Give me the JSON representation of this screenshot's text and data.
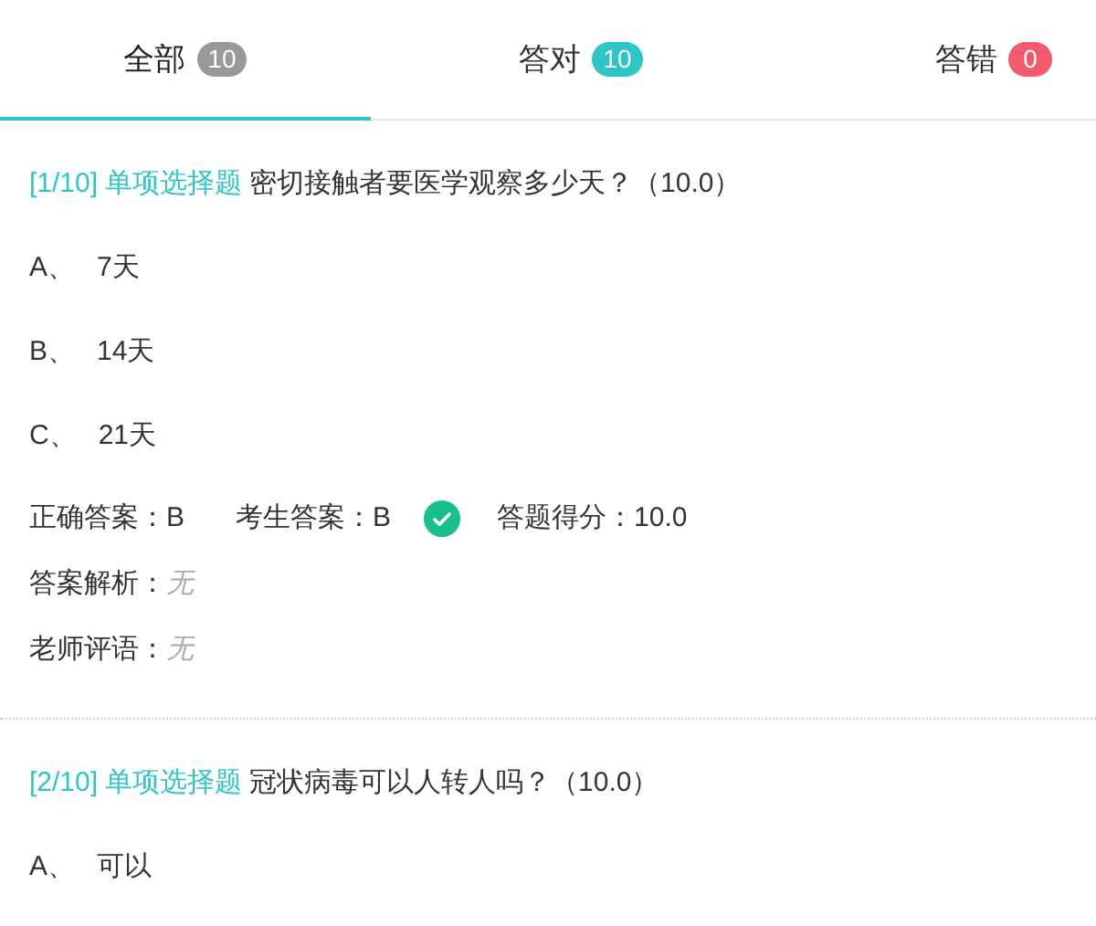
{
  "tabs": [
    {
      "label": "全部",
      "count": "10",
      "color": "#999999",
      "selected": true
    },
    {
      "label": "答对",
      "count": "10",
      "color": "#2cc6c6",
      "selected": false
    },
    {
      "label": "答错",
      "count": "0",
      "color": "#f35a6e",
      "selected": false
    }
  ],
  "questions": [
    {
      "index": "[1/10]",
      "type": "单项选择题",
      "text": "密切接触者要医学观察多少天？（10.0）",
      "options": [
        {
          "letter": "A、",
          "text": "7天"
        },
        {
          "letter": "B、",
          "text": "14天"
        },
        {
          "letter": "C、",
          "text": "21天"
        }
      ],
      "result": {
        "correct_label": "正确答案：",
        "correct_value": "B",
        "student_label": "考生答案：",
        "student_value": "B",
        "is_correct": true,
        "score_label": "答题得分：",
        "score_value": "10.0"
      },
      "analysis": {
        "label": "答案解析：",
        "value": "无"
      },
      "comment": {
        "label": "老师评语：",
        "value": "无"
      }
    },
    {
      "index": "[2/10]",
      "type": "单项选择题",
      "text": "冠状病毒可以人转人吗？（10.0）",
      "options": [
        {
          "letter": "A、",
          "text": "可以"
        }
      ]
    }
  ]
}
